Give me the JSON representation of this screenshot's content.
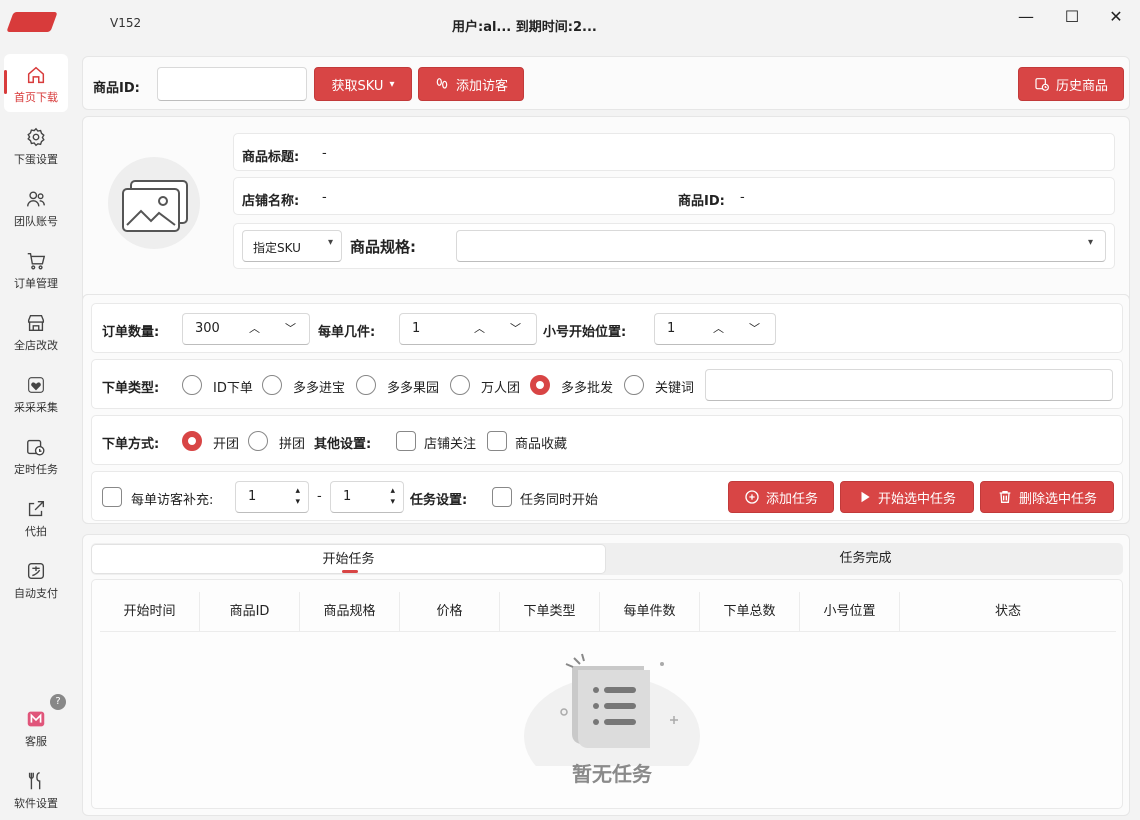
{
  "titlebar": {
    "version": "V152",
    "user_info": "用户:al... 到期时间:2..."
  },
  "sidebar": {
    "items": [
      {
        "label": "首页下载",
        "icon": "home-icon"
      },
      {
        "label": "下蛋设置",
        "icon": "gear-icon"
      },
      {
        "label": "团队账号",
        "icon": "users-icon"
      },
      {
        "label": "订单管理",
        "icon": "cart-icon"
      },
      {
        "label": "全店改改",
        "icon": "store-icon"
      },
      {
        "label": "采采采集",
        "icon": "heart-icon"
      },
      {
        "label": "定时任务",
        "icon": "clock-icon"
      },
      {
        "label": "代拍",
        "icon": "external-icon"
      },
      {
        "label": "自动支付",
        "icon": "pay-icon"
      },
      {
        "label": "客服",
        "icon": "support-icon"
      },
      {
        "label": "软件设置",
        "icon": "tools-icon"
      }
    ]
  },
  "topbar": {
    "product_id_label": "商品ID:",
    "product_id_value": "",
    "get_sku": "获取SKU",
    "add_visitor": "添加访客",
    "history": "历史商品"
  },
  "product": {
    "title_label": "商品标题:",
    "title_value": "-",
    "shop_label": "店铺名称:",
    "shop_value": "-",
    "pid_label": "商品ID:",
    "pid_value": "-",
    "sku_select": "指定SKU",
    "spec_label": "商品规格:",
    "spec_value": ""
  },
  "order": {
    "qty_label": "订单数量:",
    "qty_value": "300",
    "per_label": "每单几件:",
    "per_value": "1",
    "start_label": "小号开始位置:",
    "start_value": "1"
  },
  "type": {
    "label": "下单类型:",
    "options": [
      "ID下单",
      "多多进宝",
      "多多果园",
      "万人团",
      "多多批发",
      "关键词"
    ],
    "selected": "多多批发",
    "keyword_value": ""
  },
  "method": {
    "label": "下单方式:",
    "options": [
      "开团",
      "拼团"
    ],
    "selected": "开团",
    "other_label": "其他设置:",
    "follow_shop": "店铺关注",
    "fav_product": "商品收藏"
  },
  "visitor": {
    "label": "每单访客补充:",
    "from": "1",
    "dash": "-",
    "to": "1",
    "task_label": "任务设置:",
    "simultaneous": "任务同时开始"
  },
  "actions": {
    "add": "添加任务",
    "start": "开始选中任务",
    "delete": "删除选中任务"
  },
  "tabs": [
    "开始任务",
    "任务完成"
  ],
  "table": {
    "columns": [
      "开始时间",
      "商品ID",
      "商品规格",
      "价格",
      "下单类型",
      "每单件数",
      "下单总数",
      "小号位置",
      "状态"
    ]
  },
  "empty": {
    "text": "暂无任务"
  },
  "colors": {
    "accent": "#d84545"
  }
}
